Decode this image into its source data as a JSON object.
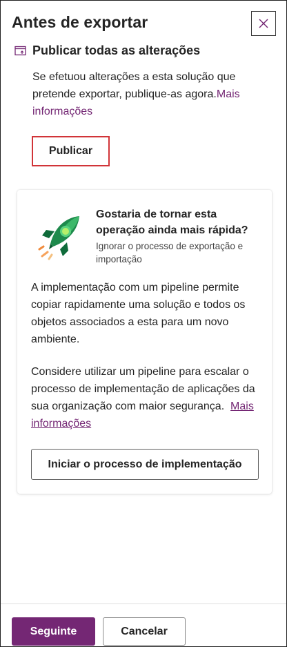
{
  "panel": {
    "title": "Antes de exportar",
    "close_icon": "close-icon"
  },
  "publish_section": {
    "icon": "publish-window-icon",
    "heading": "Publicar todas as alterações",
    "description": "Se efetuou alterações a esta solução que pretende exportar, publique-as agora.",
    "link": "Mais informações",
    "button_label": "Publicar"
  },
  "pipeline_card": {
    "icon": "rocket-icon",
    "heading": "Gostaria de tornar esta operação ainda mais rápida?",
    "subheading": "Ignorar o processo de exportação e importação",
    "paragraph1": "A implementação com um pipeline permite copiar rapidamente uma solução e todos os objetos associados a esta para um novo ambiente.",
    "paragraph2": "Considere utilizar um pipeline para escalar o processo de implementação de aplicações da sua organização com maior segurança.",
    "link": "Mais informações",
    "button_label": "Iniciar o processo de implementação"
  },
  "footer": {
    "next_label": "Seguinte",
    "cancel_label": "Cancelar"
  },
  "colors": {
    "accent": "#742774",
    "focus_border": "#d13438",
    "rocket_green": "#1e8a4c"
  }
}
